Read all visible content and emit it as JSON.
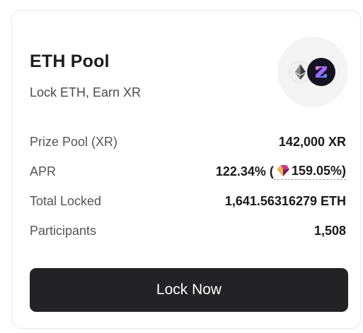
{
  "pool": {
    "title": "ETH Pool",
    "subtitle": "Lock ETH, Earn XR",
    "tokens": [
      "eth-icon",
      "xr-icon"
    ]
  },
  "stats": {
    "prize_pool": {
      "label": "Prize Pool (XR)",
      "value": "142,000 XR"
    },
    "apr": {
      "label": "APR",
      "value": "122.34% (",
      "boost": "159.05%)",
      "boost_icon": "gem-icon"
    },
    "total_locked": {
      "label": "Total Locked",
      "value": "1,641.56316279 ETH"
    },
    "participants": {
      "label": "Participants",
      "value": "1,508"
    }
  },
  "actions": {
    "lock_label": "Lock Now"
  },
  "colors": {
    "button_bg": "#232326",
    "button_text": "#ffffff",
    "xr_token_bg": "#17121f",
    "xr_accent": "#8b5cf6"
  }
}
